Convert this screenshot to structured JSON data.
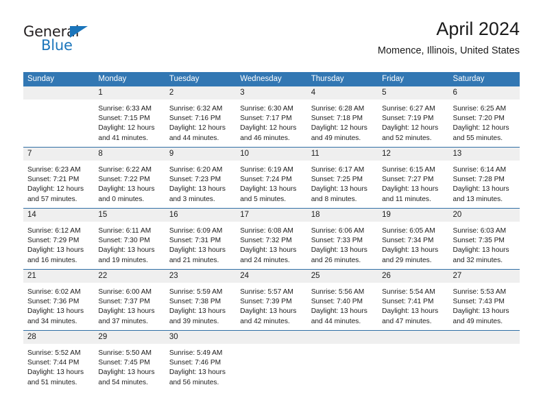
{
  "logo": {
    "text_primary": "General",
    "text_secondary": "Blue",
    "triangle_icon": "triangle-icon",
    "color_primary": "#231f20",
    "color_secondary": "#1b75bb"
  },
  "header": {
    "title": "April 2024",
    "subtitle": "Momence, Illinois, United States"
  },
  "theme": {
    "header_blue": "#3277b3",
    "separator_blue": "#2e6da4",
    "day_band_gray": "#efefef",
    "text": "#1a1a1a"
  },
  "weekdays": [
    "Sunday",
    "Monday",
    "Tuesday",
    "Wednesday",
    "Thursday",
    "Friday",
    "Saturday"
  ],
  "weeks": [
    [
      {
        "day": "",
        "lines": [
          "",
          "",
          "",
          ""
        ],
        "empty": true
      },
      {
        "day": "1",
        "lines": [
          "Sunrise: 6:33 AM",
          "Sunset: 7:15 PM",
          "Daylight: 12 hours",
          "and 41 minutes."
        ]
      },
      {
        "day": "2",
        "lines": [
          "Sunrise: 6:32 AM",
          "Sunset: 7:16 PM",
          "Daylight: 12 hours",
          "and 44 minutes."
        ]
      },
      {
        "day": "3",
        "lines": [
          "Sunrise: 6:30 AM",
          "Sunset: 7:17 PM",
          "Daylight: 12 hours",
          "and 46 minutes."
        ]
      },
      {
        "day": "4",
        "lines": [
          "Sunrise: 6:28 AM",
          "Sunset: 7:18 PM",
          "Daylight: 12 hours",
          "and 49 minutes."
        ]
      },
      {
        "day": "5",
        "lines": [
          "Sunrise: 6:27 AM",
          "Sunset: 7:19 PM",
          "Daylight: 12 hours",
          "and 52 minutes."
        ]
      },
      {
        "day": "6",
        "lines": [
          "Sunrise: 6:25 AM",
          "Sunset: 7:20 PM",
          "Daylight: 12 hours",
          "and 55 minutes."
        ]
      }
    ],
    [
      {
        "day": "7",
        "lines": [
          "Sunrise: 6:23 AM",
          "Sunset: 7:21 PM",
          "Daylight: 12 hours",
          "and 57 minutes."
        ]
      },
      {
        "day": "8",
        "lines": [
          "Sunrise: 6:22 AM",
          "Sunset: 7:22 PM",
          "Daylight: 13 hours",
          "and 0 minutes."
        ]
      },
      {
        "day": "9",
        "lines": [
          "Sunrise: 6:20 AM",
          "Sunset: 7:23 PM",
          "Daylight: 13 hours",
          "and 3 minutes."
        ]
      },
      {
        "day": "10",
        "lines": [
          "Sunrise: 6:19 AM",
          "Sunset: 7:24 PM",
          "Daylight: 13 hours",
          "and 5 minutes."
        ]
      },
      {
        "day": "11",
        "lines": [
          "Sunrise: 6:17 AM",
          "Sunset: 7:25 PM",
          "Daylight: 13 hours",
          "and 8 minutes."
        ]
      },
      {
        "day": "12",
        "lines": [
          "Sunrise: 6:15 AM",
          "Sunset: 7:27 PM",
          "Daylight: 13 hours",
          "and 11 minutes."
        ]
      },
      {
        "day": "13",
        "lines": [
          "Sunrise: 6:14 AM",
          "Sunset: 7:28 PM",
          "Daylight: 13 hours",
          "and 13 minutes."
        ]
      }
    ],
    [
      {
        "day": "14",
        "lines": [
          "Sunrise: 6:12 AM",
          "Sunset: 7:29 PM",
          "Daylight: 13 hours",
          "and 16 minutes."
        ]
      },
      {
        "day": "15",
        "lines": [
          "Sunrise: 6:11 AM",
          "Sunset: 7:30 PM",
          "Daylight: 13 hours",
          "and 19 minutes."
        ]
      },
      {
        "day": "16",
        "lines": [
          "Sunrise: 6:09 AM",
          "Sunset: 7:31 PM",
          "Daylight: 13 hours",
          "and 21 minutes."
        ]
      },
      {
        "day": "17",
        "lines": [
          "Sunrise: 6:08 AM",
          "Sunset: 7:32 PM",
          "Daylight: 13 hours",
          "and 24 minutes."
        ]
      },
      {
        "day": "18",
        "lines": [
          "Sunrise: 6:06 AM",
          "Sunset: 7:33 PM",
          "Daylight: 13 hours",
          "and 26 minutes."
        ]
      },
      {
        "day": "19",
        "lines": [
          "Sunrise: 6:05 AM",
          "Sunset: 7:34 PM",
          "Daylight: 13 hours",
          "and 29 minutes."
        ]
      },
      {
        "day": "20",
        "lines": [
          "Sunrise: 6:03 AM",
          "Sunset: 7:35 PM",
          "Daylight: 13 hours",
          "and 32 minutes."
        ]
      }
    ],
    [
      {
        "day": "21",
        "lines": [
          "Sunrise: 6:02 AM",
          "Sunset: 7:36 PM",
          "Daylight: 13 hours",
          "and 34 minutes."
        ]
      },
      {
        "day": "22",
        "lines": [
          "Sunrise: 6:00 AM",
          "Sunset: 7:37 PM",
          "Daylight: 13 hours",
          "and 37 minutes."
        ]
      },
      {
        "day": "23",
        "lines": [
          "Sunrise: 5:59 AM",
          "Sunset: 7:38 PM",
          "Daylight: 13 hours",
          "and 39 minutes."
        ]
      },
      {
        "day": "24",
        "lines": [
          "Sunrise: 5:57 AM",
          "Sunset: 7:39 PM",
          "Daylight: 13 hours",
          "and 42 minutes."
        ]
      },
      {
        "day": "25",
        "lines": [
          "Sunrise: 5:56 AM",
          "Sunset: 7:40 PM",
          "Daylight: 13 hours",
          "and 44 minutes."
        ]
      },
      {
        "day": "26",
        "lines": [
          "Sunrise: 5:54 AM",
          "Sunset: 7:41 PM",
          "Daylight: 13 hours",
          "and 47 minutes."
        ]
      },
      {
        "day": "27",
        "lines": [
          "Sunrise: 5:53 AM",
          "Sunset: 7:43 PM",
          "Daylight: 13 hours",
          "and 49 minutes."
        ]
      }
    ],
    [
      {
        "day": "28",
        "lines": [
          "Sunrise: 5:52 AM",
          "Sunset: 7:44 PM",
          "Daylight: 13 hours",
          "and 51 minutes."
        ]
      },
      {
        "day": "29",
        "lines": [
          "Sunrise: 5:50 AM",
          "Sunset: 7:45 PM",
          "Daylight: 13 hours",
          "and 54 minutes."
        ]
      },
      {
        "day": "30",
        "lines": [
          "Sunrise: 5:49 AM",
          "Sunset: 7:46 PM",
          "Daylight: 13 hours",
          "and 56 minutes."
        ]
      },
      {
        "day": "",
        "lines": [
          "",
          "",
          "",
          ""
        ],
        "empty": true
      },
      {
        "day": "",
        "lines": [
          "",
          "",
          "",
          ""
        ],
        "empty": true
      },
      {
        "day": "",
        "lines": [
          "",
          "",
          "",
          ""
        ],
        "empty": true
      },
      {
        "day": "",
        "lines": [
          "",
          "",
          "",
          ""
        ],
        "empty": true
      }
    ]
  ]
}
